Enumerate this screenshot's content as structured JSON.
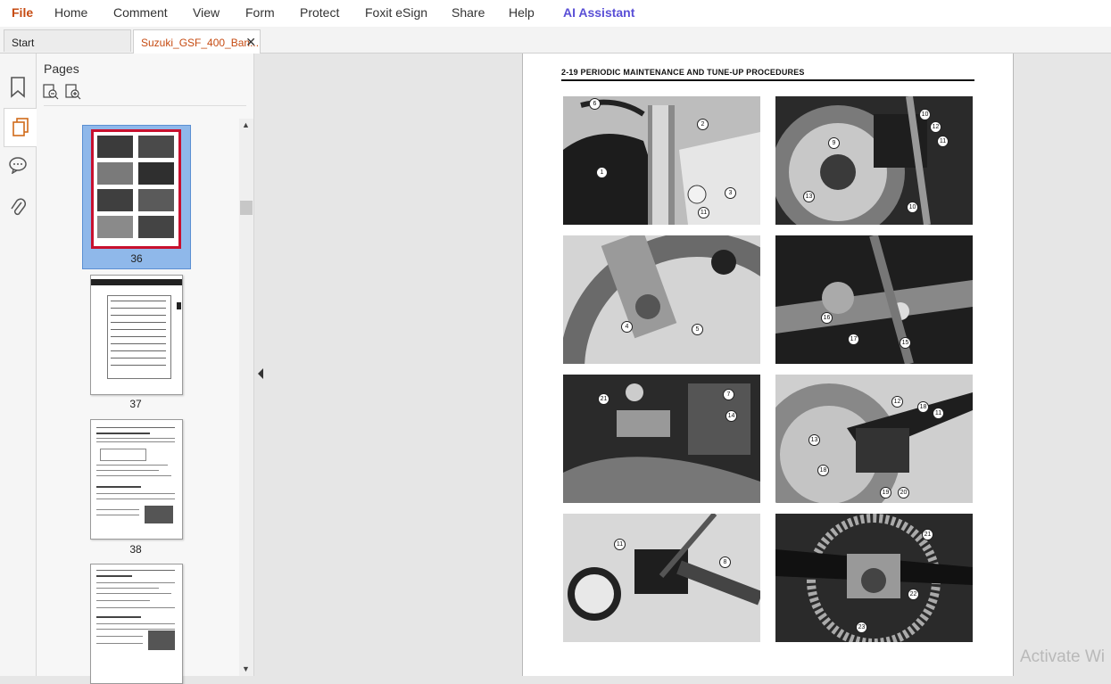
{
  "menu": {
    "file": "File",
    "home": "Home",
    "comment": "Comment",
    "view": "View",
    "form": "Form",
    "protect": "Protect",
    "esign": "Foxit eSign",
    "share": "Share",
    "help": "Help",
    "ai": "AI Assistant"
  },
  "tabs": [
    {
      "label": "Start"
    },
    {
      "label": "Suzuki_GSF_400_Ban..."
    }
  ],
  "pages_panel": {
    "title": "Pages",
    "thumbnails": [
      {
        "page": "36",
        "selected": true
      },
      {
        "page": "37"
      },
      {
        "page": "38"
      }
    ]
  },
  "document": {
    "header": "2-19  PERIODIC MAINTENANCE AND TUNE-UP PROCEDURES",
    "callouts": [
      "6",
      "2",
      "1",
      "3",
      "11",
      "10",
      "12",
      "9",
      "11",
      "13",
      "10",
      "4",
      "5",
      "16",
      "17",
      "15",
      "21",
      "7",
      "14",
      "12",
      "18",
      "11",
      "13",
      "18",
      "19",
      "20",
      "11",
      "8",
      "21",
      "22",
      "23"
    ]
  },
  "watermark": "Activate Wi",
  "colors": {
    "accent": "#c64b12",
    "ai": "#5a4fd6",
    "selection": "#8fb8ea"
  },
  "icons": [
    "bookmark-icon",
    "pages-icon",
    "comment-icon",
    "attachment-icon",
    "thumbnail-zoom-out-icon",
    "thumbnail-zoom-in-icon",
    "close-icon",
    "collapse-arrow-icon"
  ]
}
